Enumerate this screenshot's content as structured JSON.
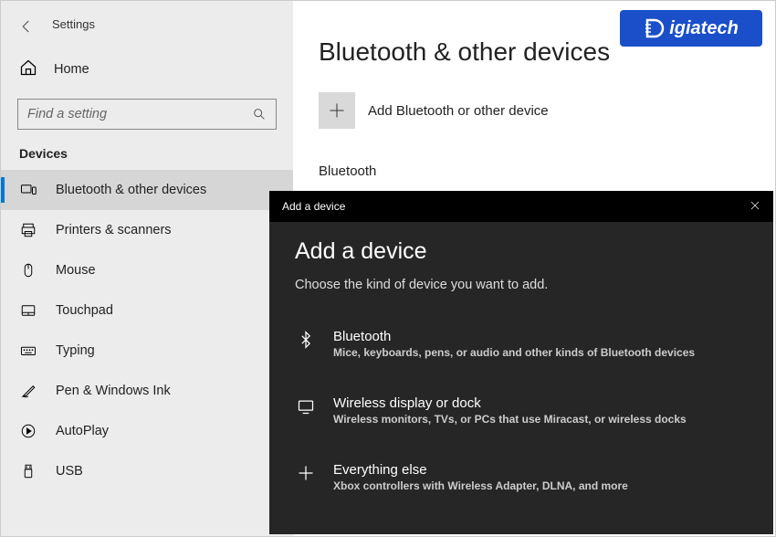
{
  "window": {
    "title": "Settings"
  },
  "sidebar": {
    "home_label": "Home",
    "search_placeholder": "Find a setting",
    "section_header": "Devices",
    "items": [
      {
        "label": "Bluetooth & other devices"
      },
      {
        "label": "Printers & scanners"
      },
      {
        "label": "Mouse"
      },
      {
        "label": "Touchpad"
      },
      {
        "label": "Typing"
      },
      {
        "label": "Pen & Windows Ink"
      },
      {
        "label": "AutoPlay"
      },
      {
        "label": "USB"
      }
    ]
  },
  "main": {
    "heading": "Bluetooth & other devices",
    "add_device_label": "Add Bluetooth or other device",
    "subheading": "Bluetooth"
  },
  "modal": {
    "header_title": "Add a device",
    "title": "Add a device",
    "subtitle": "Choose the kind of device you want to add.",
    "options": [
      {
        "title": "Bluetooth",
        "desc": "Mice, keyboards, pens, or audio and other kinds of Bluetooth devices"
      },
      {
        "title": "Wireless display or dock",
        "desc": "Wireless monitors, TVs, or PCs that use Miracast, or wireless docks"
      },
      {
        "title": "Everything else",
        "desc": "Xbox controllers with Wireless Adapter, DLNA, and more"
      }
    ]
  },
  "logo": {
    "text": "igiatech"
  }
}
